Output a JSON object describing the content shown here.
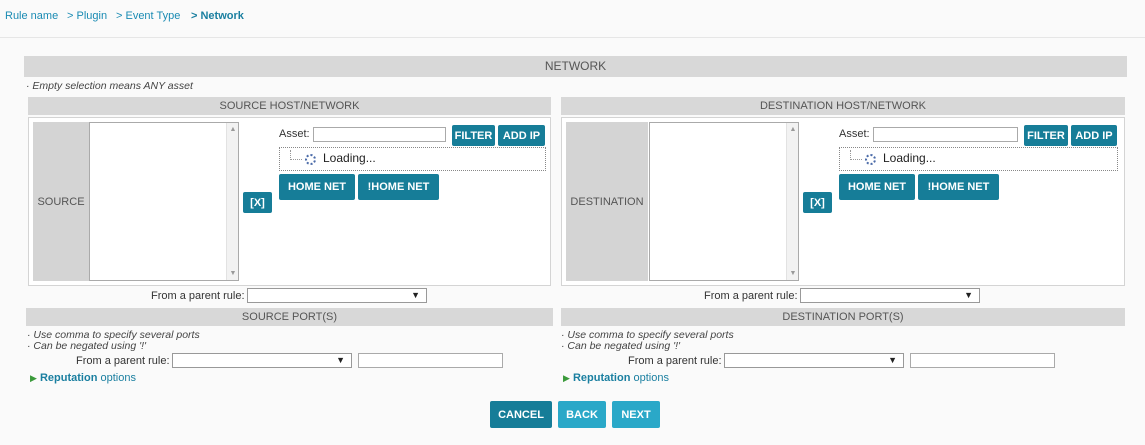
{
  "breadcrumb": [
    "Rule name",
    "> Plugin",
    "> Event Type",
    "> Network"
  ],
  "section_title": "NETWORK",
  "note_empty": "· Empty selection means ANY asset",
  "source": {
    "header": "SOURCE HOST/NETWORK",
    "side_label": "SOURCE",
    "asset_label": "Asset:",
    "filter": "FILTER",
    "add_ip": "ADD IP",
    "loading": "Loading...",
    "home_net": "HOME NET",
    "not_home_net": "!HOME NET",
    "clear": "[X]",
    "parent_rule_label": "From a parent rule:",
    "parent_rule_value": ""
  },
  "destination": {
    "header": "DESTINATION HOST/NETWORK",
    "side_label": "DESTINATION",
    "asset_label": "Asset:",
    "filter": "FILTER",
    "add_ip": "ADD IP",
    "loading": "Loading...",
    "home_net": "HOME NET",
    "not_home_net": "!HOME NET",
    "clear": "[X]",
    "parent_rule_label": "From a parent rule:",
    "parent_rule_value": ""
  },
  "source_port": {
    "header": "SOURCE PORT(S)",
    "note1": "· Use comma to specify several ports",
    "note2": "· Can be negated using '!'",
    "parent_rule_label": "From a parent rule:",
    "parent_rule_value": "",
    "port_value": "",
    "reputation_bold": "Reputation",
    "reputation_rest": " options"
  },
  "destination_port": {
    "header": "DESTINATION PORT(S)",
    "note1": "· Use comma to specify several ports",
    "note2": "· Can be negated using '!'",
    "parent_rule_label": "From a parent rule:",
    "parent_rule_value": "",
    "port_value": "",
    "reputation_bold": "Reputation",
    "reputation_rest": " options"
  },
  "buttons": {
    "cancel": "CANCEL",
    "back": "BACK",
    "next": "NEXT"
  },
  "colors": {
    "primary": "#167d98",
    "secondary": "#2aa8c8",
    "link": "#1a8bb3",
    "header_bar": "#d8d8d8"
  }
}
